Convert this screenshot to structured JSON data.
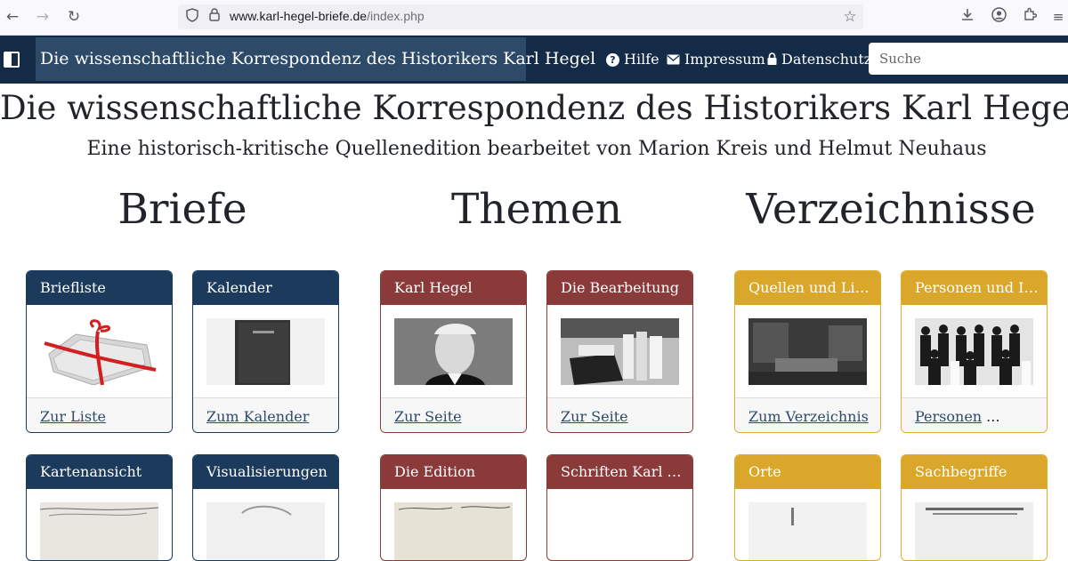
{
  "browser": {
    "url_host": "www.karl-hegel-briefe.de",
    "url_path": "/index.php",
    "icons": [
      "back-icon",
      "forward-icon",
      "reload-icon",
      "shield-icon",
      "lock-icon",
      "star-icon",
      "download-icon",
      "account-icon",
      "extensions-icon",
      "menu-icon"
    ]
  },
  "navbar": {
    "brand": "Die wissenschaftliche Korrespondenz des Historikers Karl Hegel",
    "help": "Hilfe",
    "imprint": "Impressum",
    "privacy": "Datenschutz",
    "search_placeholder": "Suche"
  },
  "header": {
    "title": "Die wissenschaftliche Korrespondenz des Historikers Karl Hegel",
    "subtitle": "Eine historisch-kritische Quellenedition bearbeitet von Marion Kreis und Helmut Neuhaus"
  },
  "sections": {
    "letters": "Briefe",
    "topics": "Themen",
    "indexes": "Verzeichnisse"
  },
  "cards": {
    "briefliste": {
      "title": "Briefliste",
      "link": "Zur Liste"
    },
    "kalender": {
      "title": "Kalender",
      "link": "Zum Kalender"
    },
    "karl_hegel": {
      "title": "Karl Hegel",
      "link": "Zur Seite"
    },
    "bearbeitung": {
      "title": "Die Bearbeitung",
      "link": "Zur Seite"
    },
    "quellen": {
      "title": "Quellen und Liter...",
      "link": "Zum Verzeichnis"
    },
    "personen": {
      "title": "Personen und Ins...",
      "link": "Personen",
      "link_suffix": " ..."
    },
    "kartenansicht": {
      "title": "Kartenansicht"
    },
    "visualisierungen": {
      "title": "Visualisierungen"
    },
    "edition": {
      "title": "Die Edition"
    },
    "schriften": {
      "title": "Schriften Karl He..."
    },
    "orte": {
      "title": "Orte"
    },
    "sachbegriffe": {
      "title": "Sachbegriffe"
    }
  },
  "colors": {
    "navbar": "#142b47",
    "briefe_accent": "#1c3a5c",
    "themen_accent": "#8a3a38",
    "verzeichnisse_accent": "#dba72a",
    "link": "#2c4a6e"
  }
}
